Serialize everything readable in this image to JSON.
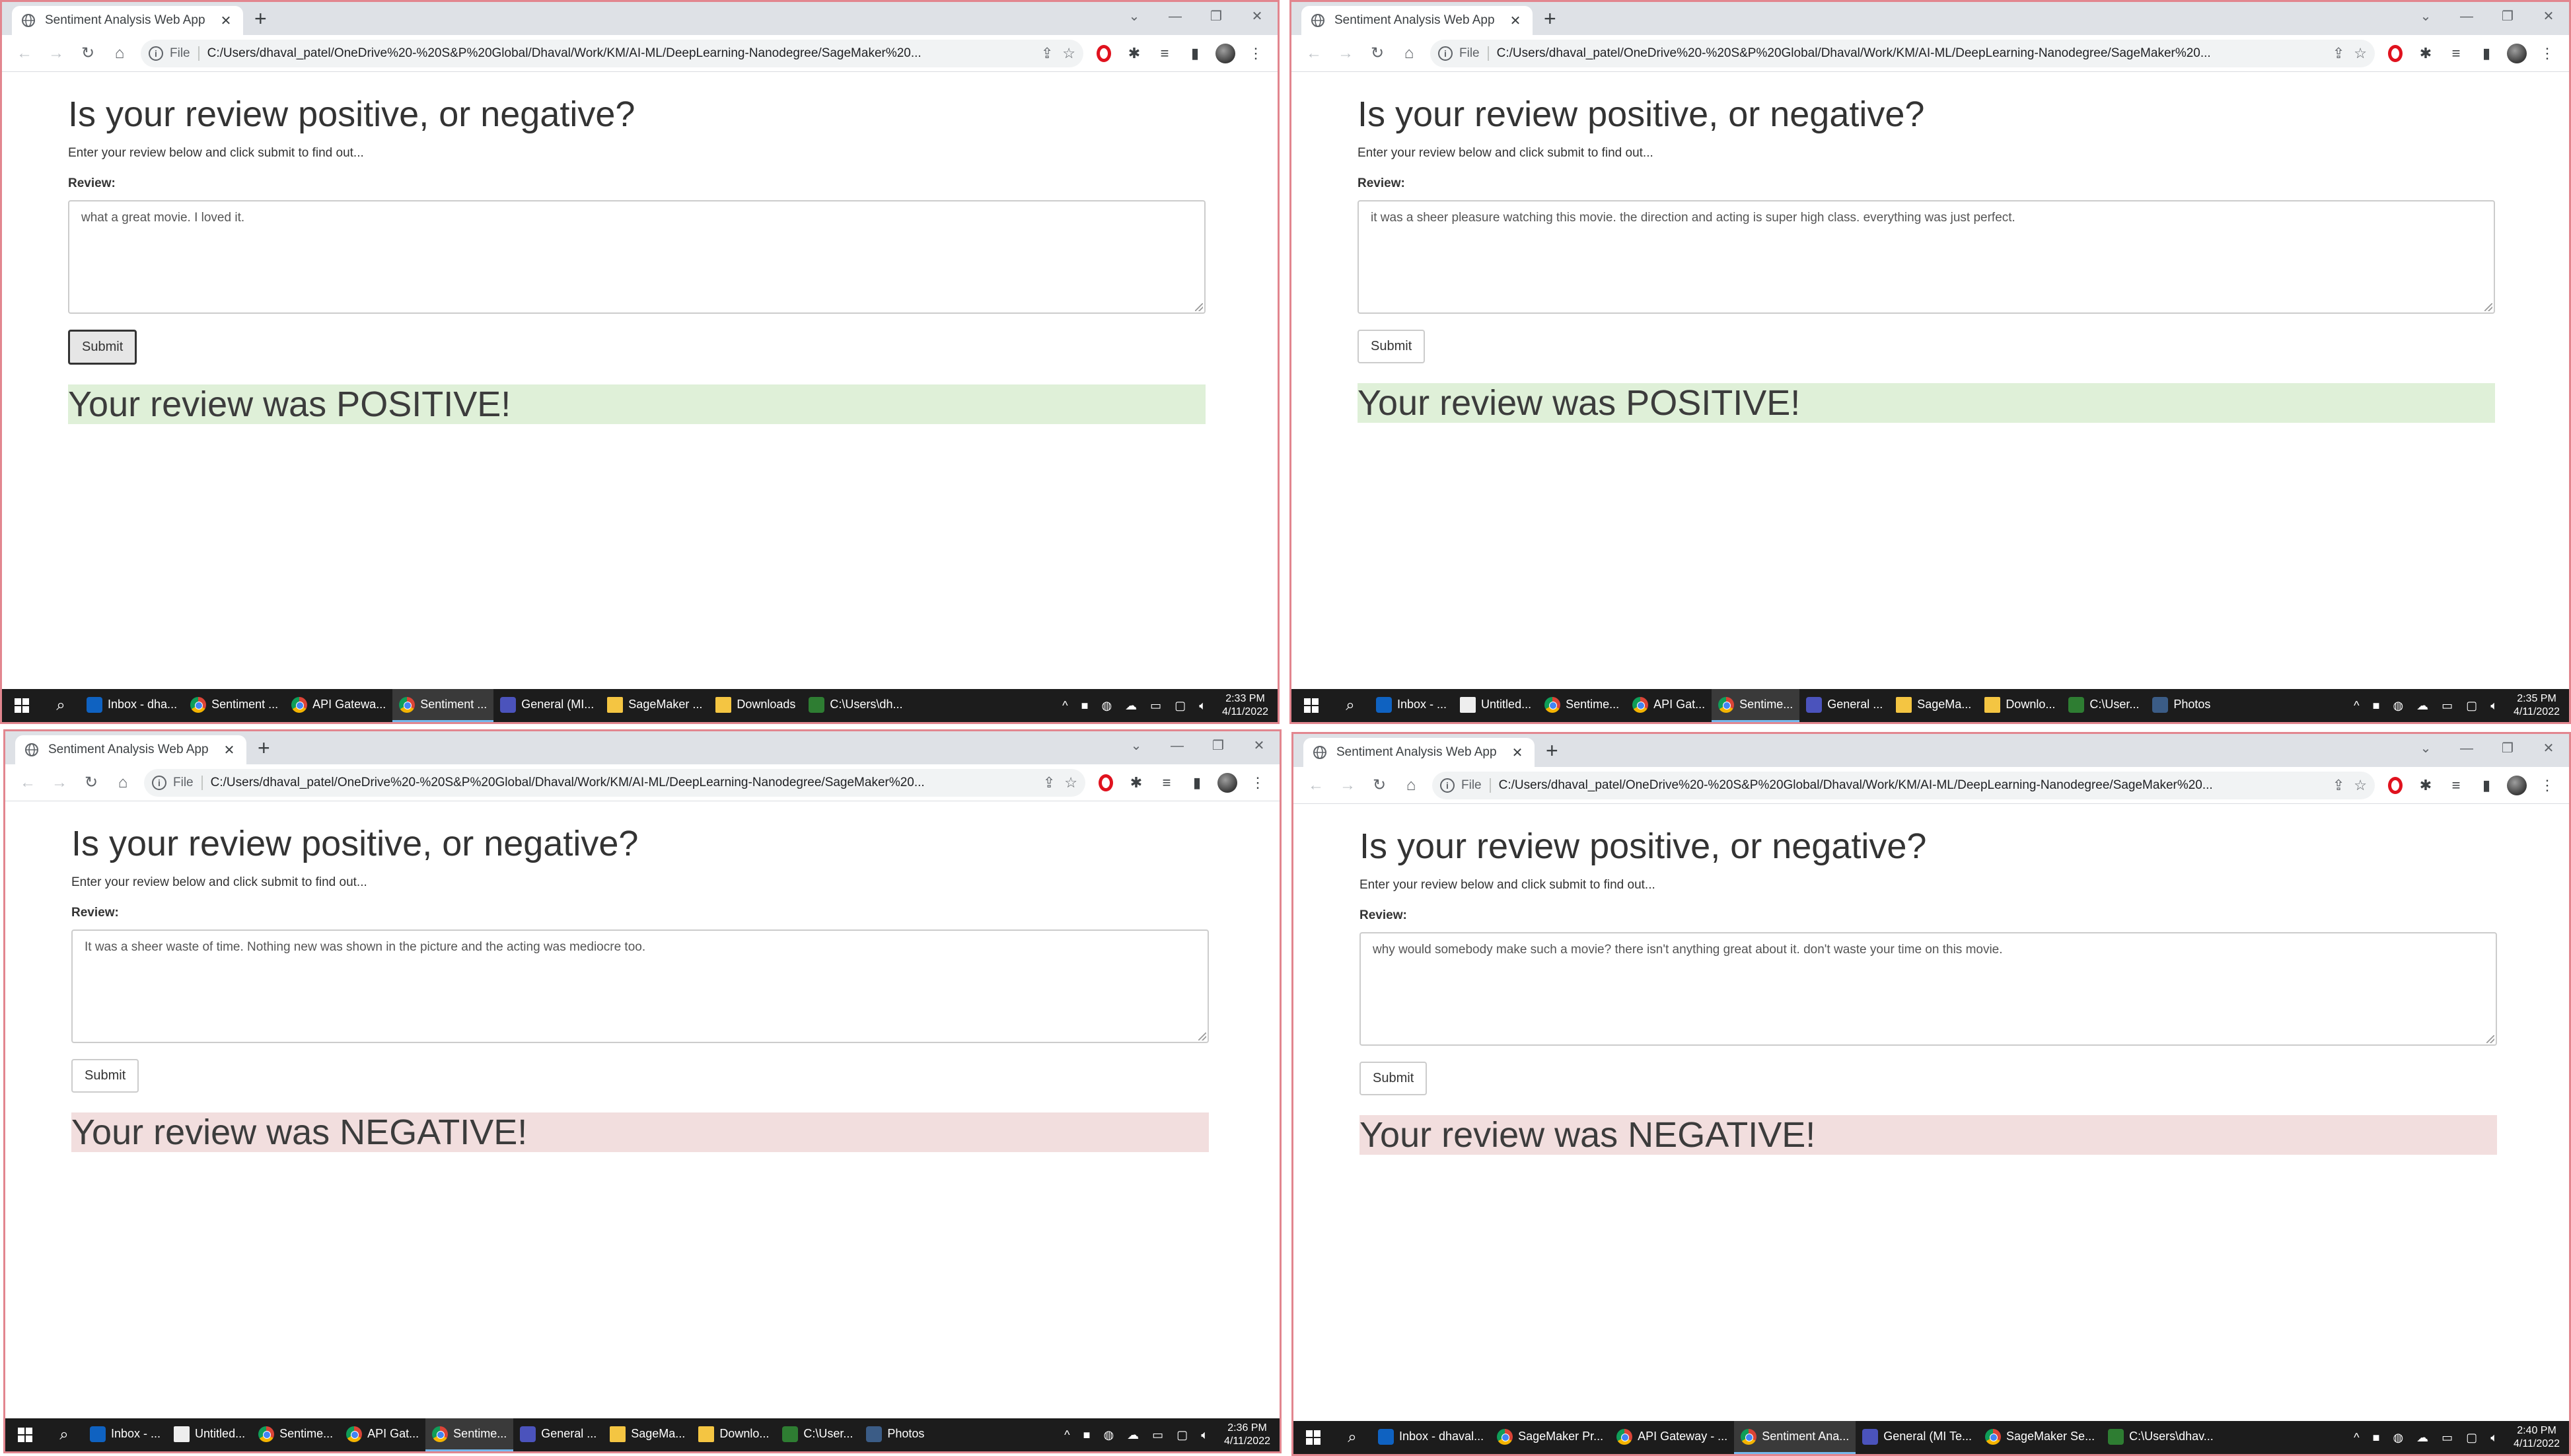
{
  "shots": [
    {
      "tab_title": "Sentiment Analysis Web App",
      "url_scheme": "File",
      "url": "C:/Users/dhaval_patel/OneDrive%20-%20S&P%20Global/Dhaval/Work/KM/AI-ML/DeepLearning-Nanodegree/SageMaker%20...",
      "heading": "Is your review positive, or negative?",
      "lead": "Enter your review below and click submit to find out...",
      "review_label": "Review:",
      "review_text": "what a great movie. I loved it.",
      "submit_label": "Submit",
      "result_text": "Your review was POSITIVE!",
      "result_sentiment": "positive",
      "result_color": "#dff0d8",
      "taskbar": [
        "Inbox - dha...",
        "Sentiment ...",
        "API Gatewa...",
        "Sentiment ...",
        "General (MI...",
        "SageMaker ...",
        "Downloads",
        "C:\\Users\\dh..."
      ],
      "clock_time": "2:33 PM",
      "clock_date": "4/11/2022"
    },
    {
      "tab_title": "Sentiment Analysis Web App",
      "url_scheme": "File",
      "url": "C:/Users/dhaval_patel/OneDrive%20-%20S&P%20Global/Dhaval/Work/KM/AI-ML/DeepLearning-Nanodegree/SageMaker%20...",
      "heading": "Is your review positive, or negative?",
      "lead": "Enter your review below and click submit to find out...",
      "review_label": "Review:",
      "review_text": "it was a sheer pleasure watching this movie. the direction and acting is super high class. everything was just perfect.",
      "submit_label": "Submit",
      "result_text": "Your review was POSITIVE!",
      "result_sentiment": "positive",
      "result_color": "#dff0d8",
      "taskbar": [
        "Inbox - ...",
        "Untitled...",
        "Sentime...",
        "API Gat...",
        "Sentime...",
        "General ...",
        "SageMa...",
        "Downlo...",
        "C:\\User...",
        "Photos"
      ],
      "clock_time": "2:35 PM",
      "clock_date": "4/11/2022"
    },
    {
      "tab_title": "Sentiment Analysis Web App",
      "url_scheme": "File",
      "url": "C:/Users/dhaval_patel/OneDrive%20-%20S&P%20Global/Dhaval/Work/KM/AI-ML/DeepLearning-Nanodegree/SageMaker%20...",
      "heading": "Is your review positive, or negative?",
      "lead": "Enter your review below and click submit to find out...",
      "review_label": "Review:",
      "review_text": "It was a sheer waste of time. Nothing new was shown in the picture and the acting was mediocre too.",
      "submit_label": "Submit",
      "result_text": "Your review was NEGATIVE!",
      "result_sentiment": "negative",
      "result_color": "#f2dede",
      "taskbar": [
        "Inbox - ...",
        "Untitled...",
        "Sentime...",
        "API Gat...",
        "Sentime...",
        "General ...",
        "SageMa...",
        "Downlo...",
        "C:\\User...",
        "Photos"
      ],
      "clock_time": "2:36 PM",
      "clock_date": "4/11/2022"
    },
    {
      "tab_title": "Sentiment Analysis Web App",
      "url_scheme": "File",
      "url": "C:/Users/dhaval_patel/OneDrive%20-%20S&P%20Global/Dhaval/Work/KM/AI-ML/DeepLearning-Nanodegree/SageMaker%20...",
      "heading": "Is your review positive, or negative?",
      "lead": "Enter your review below and click submit to find out...",
      "review_label": "Review:",
      "review_text": "why would somebody make such a movie? there isn't anything great about it. don't waste your time on this movie.",
      "submit_label": "Submit",
      "result_text": "Your review was NEGATIVE!",
      "result_sentiment": "negative",
      "result_color": "#f2dede",
      "taskbar": [
        "Inbox - dhaval...",
        "SageMaker Pr...",
        "API Gateway - ...",
        "Sentiment Ana...",
        "General (MI Te...",
        "SageMaker Se...",
        "C:\\Users\\dhav..."
      ],
      "clock_time": "2:40 PM",
      "clock_date": "4/11/2022"
    }
  ],
  "icons": {
    "favicon": "globe-icon",
    "back": "arrow-left-icon",
    "forward": "arrow-right-icon",
    "reload": "reload-icon",
    "home": "home-icon",
    "info": "info-icon",
    "share": "share-icon",
    "bookmark": "star-icon",
    "opera": "opera-icon",
    "extensions": "puzzle-icon",
    "reading_list": "reading-list-icon",
    "side_panel": "side-panel-icon",
    "avatar": "profile-avatar",
    "menu": "kebab-menu-icon"
  }
}
